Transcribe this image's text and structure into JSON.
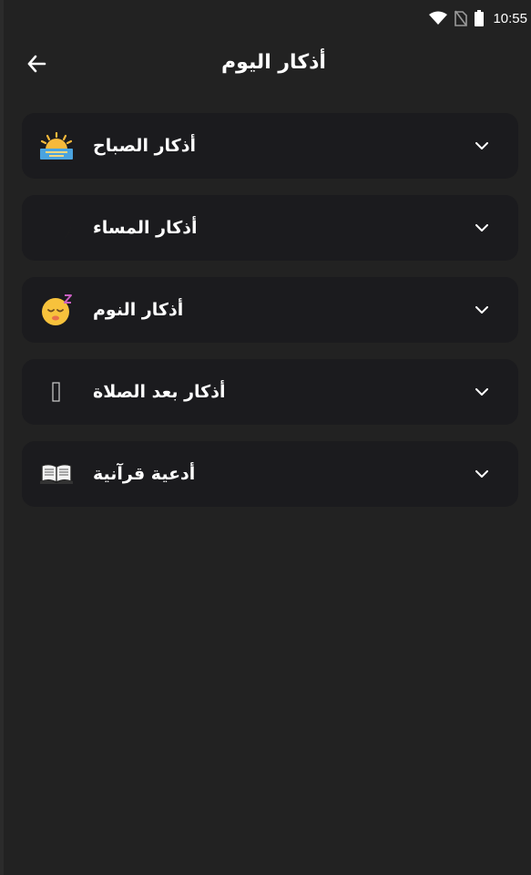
{
  "status_bar": {
    "time": "10:55",
    "icons": [
      "wifi-icon",
      "no-sim-icon",
      "battery-icon"
    ]
  },
  "header": {
    "title": "أذكار اليوم",
    "back_icon": "arrow-left-icon"
  },
  "items": [
    {
      "label": "أذكار الصباح",
      "icon": "sunrise-icon"
    },
    {
      "label": "أذكار المساء",
      "icon": "crescent-moon-icon"
    },
    {
      "label": "أذكار النوم",
      "icon": "sleeping-face-icon"
    },
    {
      "label": "أذكار بعد الصلاة",
      "icon": "missing-glyph-icon"
    },
    {
      "label": "أدعية قرآنية",
      "icon": "open-book-icon"
    }
  ],
  "colors": {
    "background": "#222222",
    "card": "#1b1b1e",
    "text": "#ffffff"
  }
}
